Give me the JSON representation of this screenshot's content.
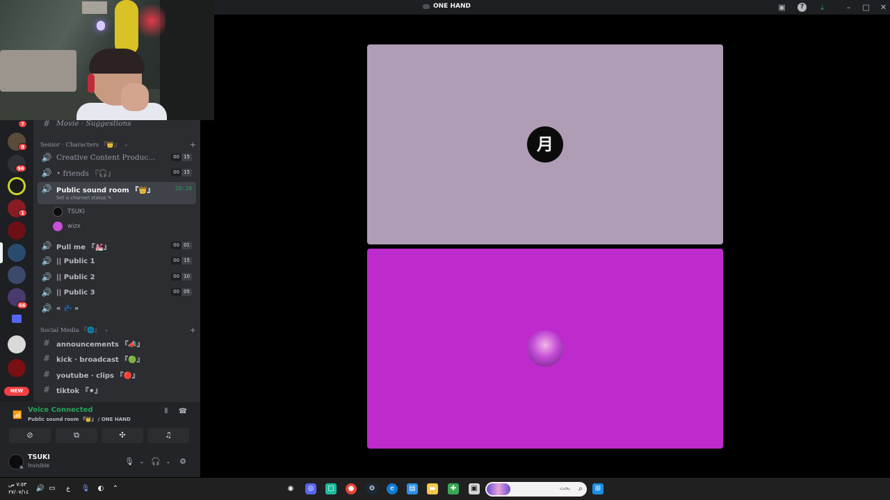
{
  "window": {
    "title": "ONE HAND",
    "icons": {
      "inbox": "inbox-icon",
      "help": "help-icon",
      "download": "download-icon",
      "minimize": "minimize-icon",
      "maximize": "maximize-icon",
      "close": "close-icon"
    }
  },
  "rail": {
    "badges": [
      "7",
      "8",
      "96",
      "1",
      "66"
    ],
    "new_label": "NEW",
    "status_dot_color": "#23a55a"
  },
  "channels": {
    "top_channel": "Movie · Suggestions",
    "category_senior": "Senior · Characters 『👑』",
    "voice1": {
      "name": "Creative Content Produc...",
      "count": "00",
      "limit": "15"
    },
    "voice2": {
      "name": "• friends 『🎧』",
      "count": "00",
      "limit": "15"
    },
    "active": {
      "name": "Public sound room 『👑』",
      "status": "Set a channel status",
      "timer": "28:20"
    },
    "users": [
      "TSUKI",
      "wizx"
    ],
    "voice3": {
      "name": "Pull me 『💒』",
      "count": "00",
      "limit": "01"
    },
    "voice4": {
      "name": "|| Public 1",
      "count": "00",
      "limit": "15"
    },
    "voice5": {
      "name": "|| Public 2",
      "count": "00",
      "limit": "10"
    },
    "voice6": {
      "name": "|| Public 3",
      "count": "00",
      "limit": "05"
    },
    "voice7": {
      "name": "« 💤 »"
    },
    "category_social": "Social Media 『🌐』",
    "text1": "announcements 『📣』",
    "text2": "kick · broadcast 『🟢』",
    "text3": "youtube · clips 『🔴』",
    "text4": "tiktok 『⚫』"
  },
  "voice_panel": {
    "title": "Voice Connected",
    "subtitle": "Public sound room 『👑』 / ONE HAND",
    "accent": "#23a55a"
  },
  "user_panel": {
    "name": "TSUKI",
    "status": "Invisible"
  },
  "stage": {
    "tile1_color": "#ae9db5",
    "tile1_avatar_glyph": "月",
    "tile2_color": "#bd2bcd"
  },
  "taskbar": {
    "search_placeholder": "بحث",
    "clock_time": "٧:٥٣ ص",
    "clock_date": "٢٧/٠٧/١٤",
    "lang": "ع"
  }
}
